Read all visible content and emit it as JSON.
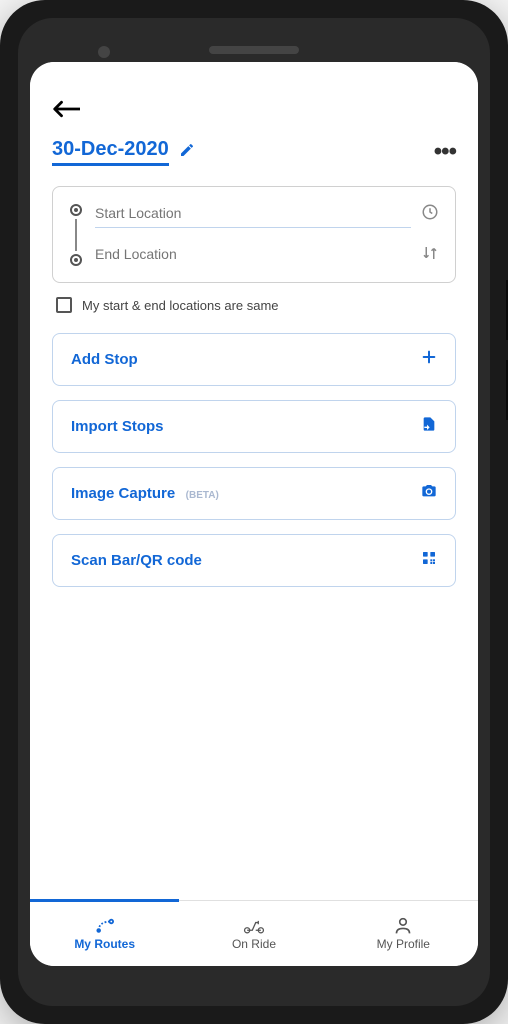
{
  "header": {
    "date": "30-Dec-2020"
  },
  "location": {
    "start_placeholder": "Start Location",
    "end_placeholder": "End Location",
    "same_location_label": "My start & end locations are same"
  },
  "actions": {
    "add_stop": "Add Stop",
    "import_stops": "Import Stops",
    "image_capture": "Image Capture",
    "image_capture_tag": "(BETA)",
    "scan_code": "Scan Bar/QR code"
  },
  "nav": {
    "my_routes": "My Routes",
    "on_ride": "On Ride",
    "my_profile": "My Profile"
  }
}
